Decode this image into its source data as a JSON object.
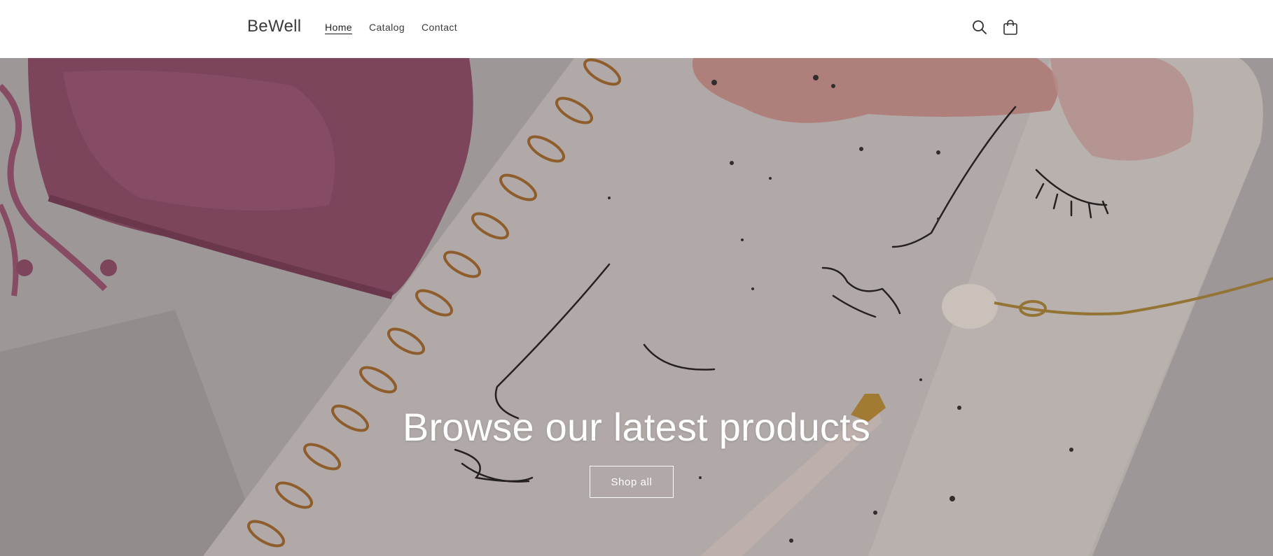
{
  "header": {
    "logo": "BeWell",
    "nav": [
      {
        "label": "Home",
        "active": true
      },
      {
        "label": "Catalog",
        "active": false
      },
      {
        "label": "Contact",
        "active": false
      }
    ],
    "icons": [
      "search-icon",
      "cart-icon"
    ]
  },
  "hero": {
    "title": "Browse our latest products",
    "button_label": "Shop all",
    "image_description_icon": "notebook-mask-pen-image"
  },
  "colors": {
    "text_dark": "#3a3a3a",
    "hero_overlay": "#7d7878",
    "mask": "#9c5674",
    "blush": "#d7a3a0",
    "spiral": "#b87a3c"
  }
}
